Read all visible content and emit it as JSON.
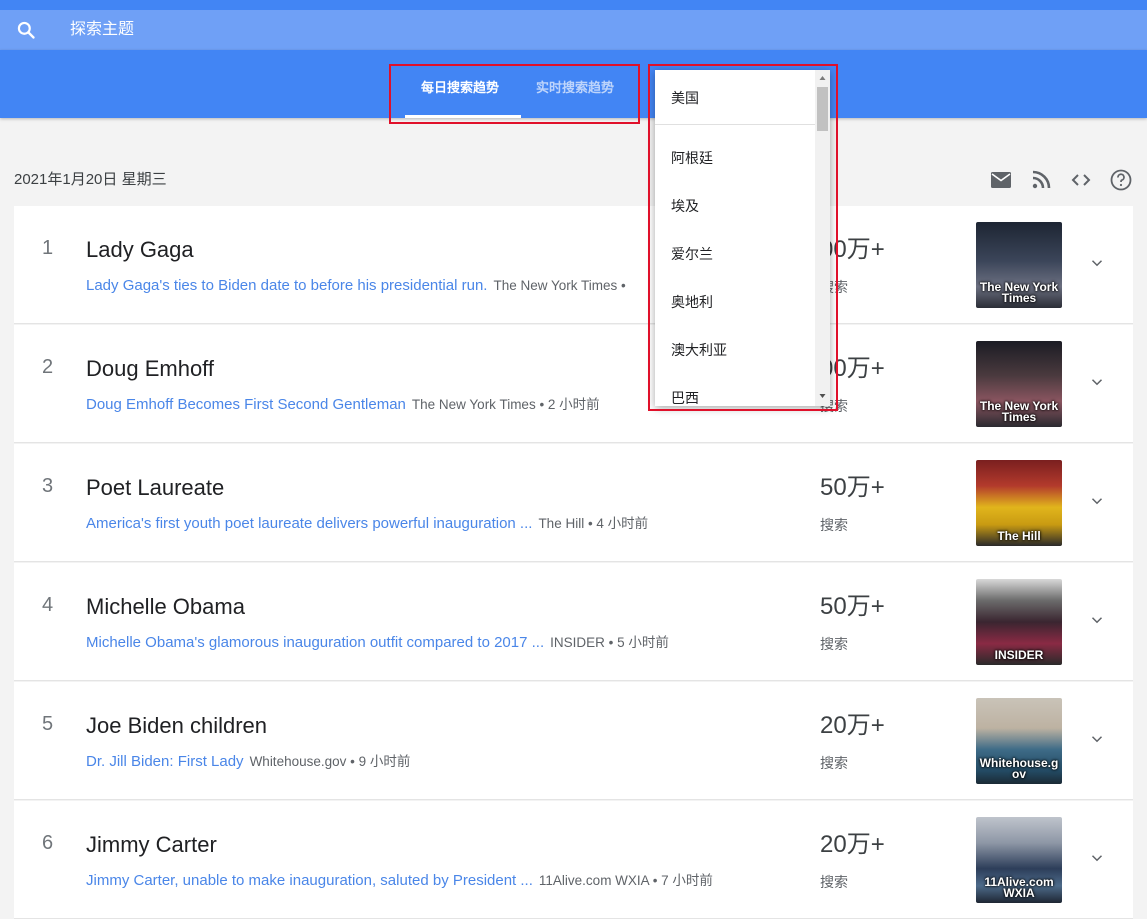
{
  "search": {
    "placeholder": "探索主题",
    "icon": "search-icon"
  },
  "tabs": [
    {
      "label": "每日搜索趋势",
      "active": true
    },
    {
      "label": "实时搜索趋势",
      "active": false
    }
  ],
  "date": "2021年1月20日 星期三",
  "toolbar_icons": [
    "email-icon",
    "rss-icon",
    "embed-code-icon",
    "help-icon"
  ],
  "trends": [
    {
      "rank": "1",
      "title": "Lady Gaga",
      "article": "Lady Gaga's ties to Biden date to before his presidential run.",
      "source": "The New York Times •",
      "count": "00万+",
      "count_label": "搜索",
      "thumb_caption": "The New York Times"
    },
    {
      "rank": "2",
      "title": "Doug Emhoff",
      "article": "Doug Emhoff Becomes First Second Gentleman",
      "source": "The New York Times • 2 小时前",
      "count": "00万+",
      "count_label": "搜索",
      "thumb_caption": "The New York Times"
    },
    {
      "rank": "3",
      "title": "Poet Laureate",
      "article": "America's first youth poet laureate delivers powerful inauguration ...",
      "source": "The Hill • 4 小时前",
      "count": "50万+",
      "count_label": "搜索",
      "thumb_caption": "The Hill"
    },
    {
      "rank": "4",
      "title": "Michelle Obama",
      "article": "Michelle Obama's glamorous inauguration outfit compared to 2017 ...",
      "source": "INSIDER • 5 小时前",
      "count": "50万+",
      "count_label": "搜索",
      "thumb_caption": "INSIDER"
    },
    {
      "rank": "5",
      "title": "Joe Biden children",
      "article": "Dr. Jill Biden: First Lady",
      "source": "Whitehouse.gov • 9 小时前",
      "count": "20万+",
      "count_label": "搜索",
      "thumb_caption": "Whitehouse.g ov"
    },
    {
      "rank": "6",
      "title": "Jimmy Carter",
      "article": "Jimmy Carter, unable to make inauguration, saluted by President ...",
      "source": "11Alive.com WXIA • 7 小时前",
      "count": "20万+",
      "count_label": "搜索",
      "thumb_caption": "11Alive.com WXIA"
    }
  ],
  "country_dropdown": {
    "selected": "美国",
    "options": [
      "阿根廷",
      "埃及",
      "爱尔兰",
      "奥地利",
      "澳大利亚",
      "巴西"
    ]
  },
  "colors": {
    "header_blue": "#4285f4",
    "searchbar_blue": "#6fa0f6",
    "link_blue": "#4a86e8",
    "highlight_red": "#e0102a"
  }
}
